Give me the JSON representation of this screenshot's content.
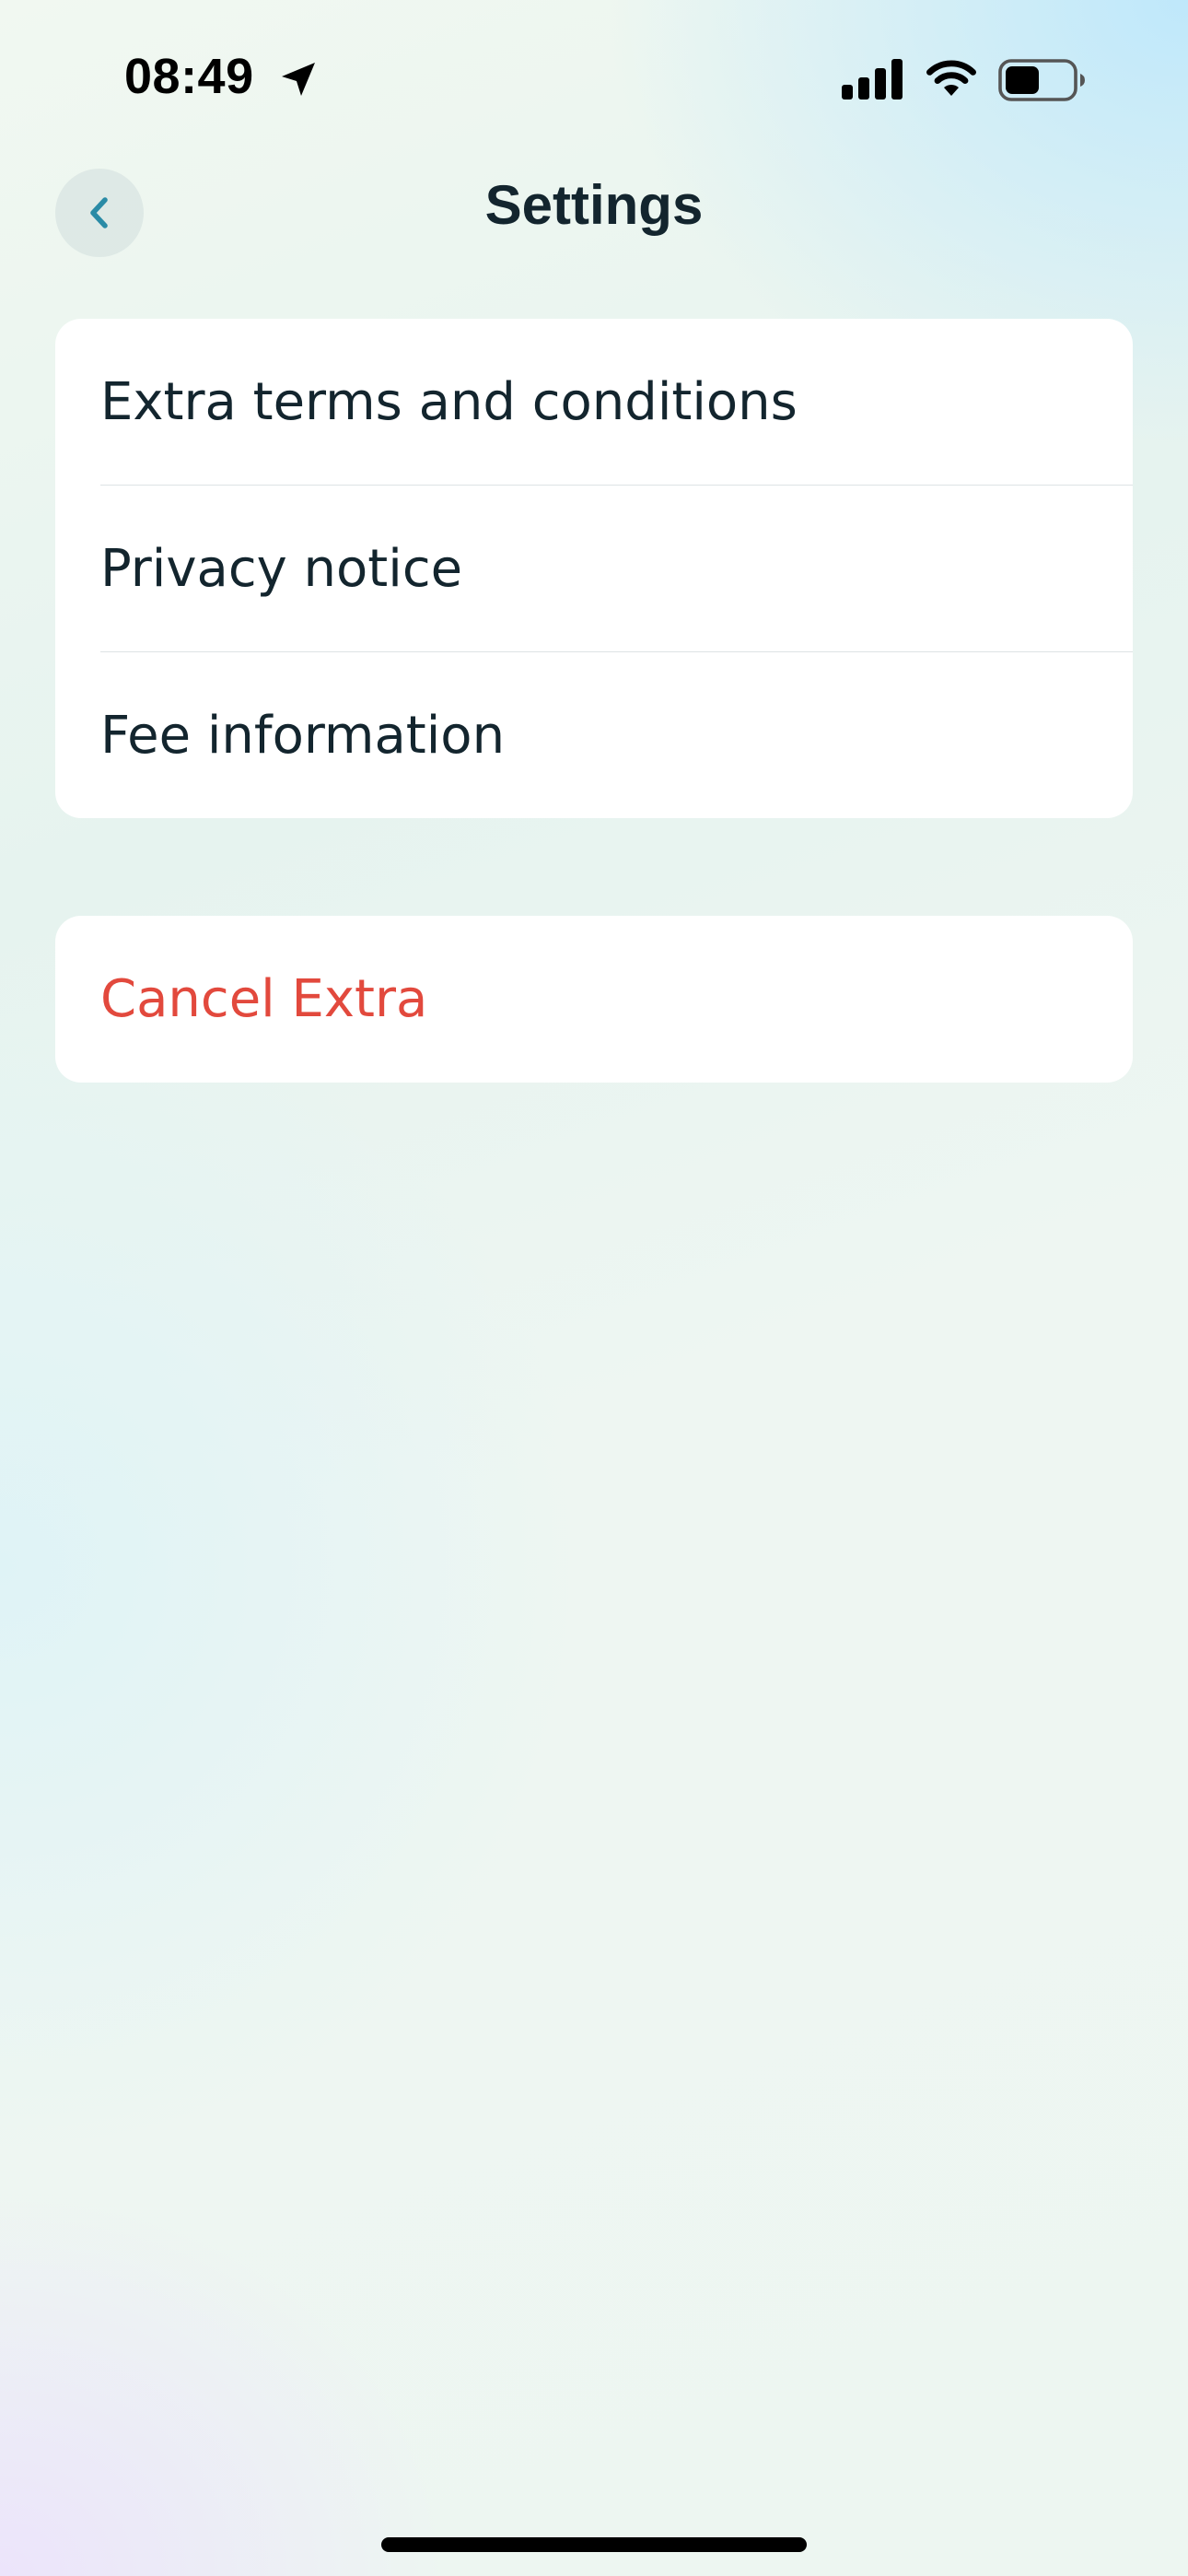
{
  "status_bar": {
    "time": "08:49",
    "icons": [
      "location-arrow-icon",
      "cellular-signal-icon",
      "wifi-icon",
      "battery-icon"
    ]
  },
  "nav": {
    "back_icon": "chevron-left-icon",
    "title": "Settings"
  },
  "settings_list": {
    "items": [
      {
        "label": "Extra terms and conditions"
      },
      {
        "label": "Privacy notice"
      },
      {
        "label": "Fee information"
      }
    ]
  },
  "cancel_section": {
    "label": "Cancel Extra"
  },
  "colors": {
    "title_text": "#13252e",
    "destructive": "#e2493d",
    "back_chevron": "#2a8ba6",
    "card_background": "#ffffff"
  }
}
